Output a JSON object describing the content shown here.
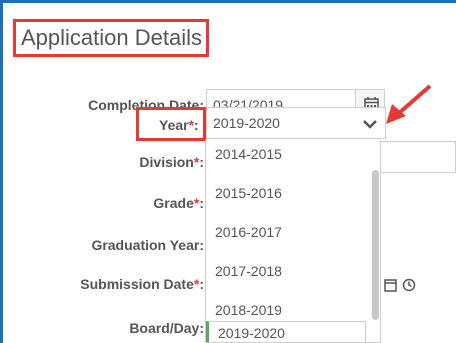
{
  "title": "Application Details",
  "labels": {
    "completion_date": "Completion Date:",
    "year": "Year",
    "division": "Division",
    "grade": "Grade",
    "graduation_year": "Graduation Year:",
    "submission_date": "Submission Date",
    "board_day": "Board/Day:",
    "required_mark": "*",
    "colon": ":"
  },
  "completion_date_value": "03/21/2019",
  "year_selected": "2019-2020",
  "year_options": [
    "2014-2015",
    "2015-2016",
    "2016-2017",
    "2017-2018",
    "2018-2019",
    "2019-2020"
  ],
  "colors": {
    "accent_red": "#e53935",
    "frame_blue": "#1f6fb5",
    "selected_green": "#4caf50"
  }
}
